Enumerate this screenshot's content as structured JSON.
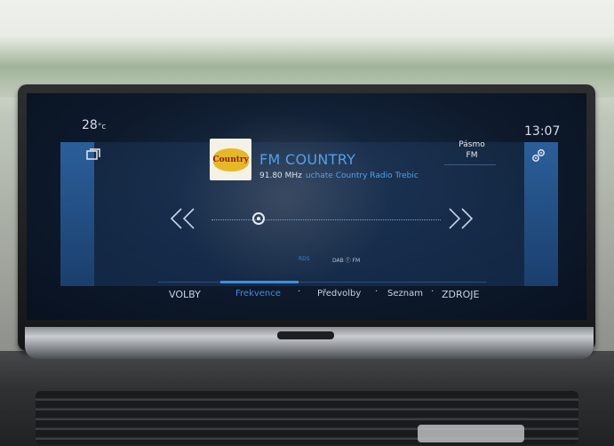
{
  "status": {
    "temperature": "28",
    "temperature_unit": "°c",
    "time": "13:07"
  },
  "icons": {
    "media": "media-source-icon",
    "settings": "settings-gear-icon"
  },
  "station": {
    "logo_text": "Country",
    "name": "FM COUNTRY",
    "frequency": "91.80 MHz",
    "radio_text": "uchate Country Radio Trebic"
  },
  "band": {
    "label": "Pásmo",
    "value": "FM"
  },
  "tuner": {
    "prev_glyph": "<<",
    "next_glyph": ">>"
  },
  "indicators": {
    "rds": "RDS",
    "dab_fm": "DAB ⓕ FM"
  },
  "tabs": {
    "volby": "VOLBY",
    "frekvence": "Frekvence",
    "predvolby": "Předvolby",
    "seznam": "Seznam",
    "zdroje": "ZDROJE",
    "separator": "·"
  },
  "colors": {
    "accent": "#3f8de0",
    "station": "#4ea0ec",
    "panel": "#1a3f6c"
  }
}
